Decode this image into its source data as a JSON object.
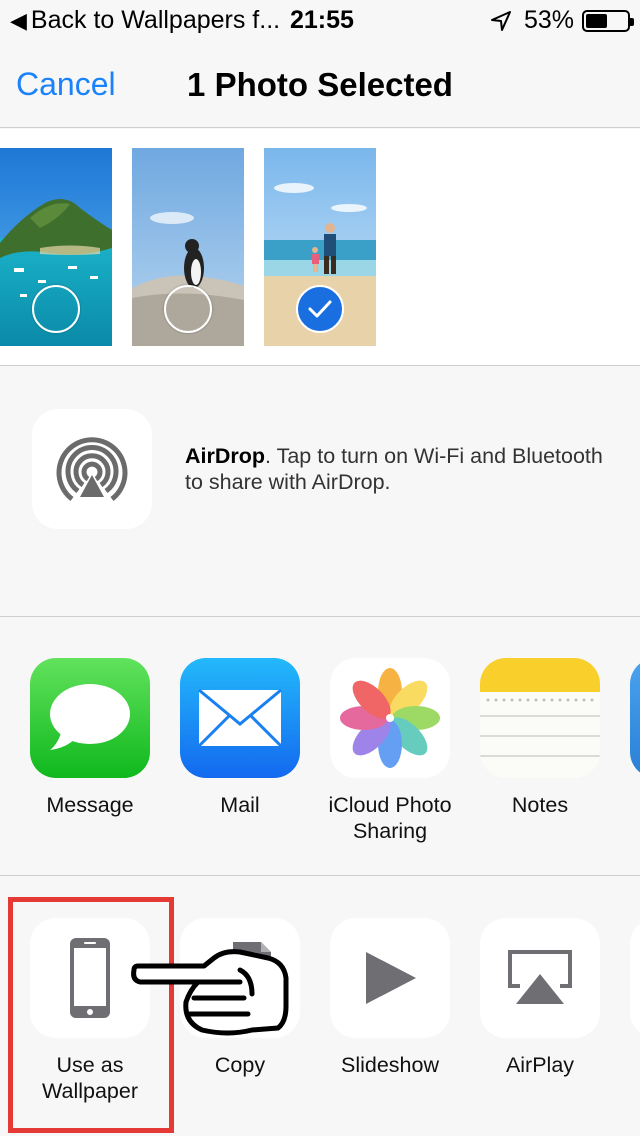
{
  "status_bar": {
    "back_label": "Back to Wallpapers f...",
    "time": "21:55",
    "battery": "53%",
    "battery_level": 0.53
  },
  "nav": {
    "cancel": "Cancel",
    "title": "1 Photo Selected"
  },
  "photos": [
    {
      "name": "Island bay with boats",
      "selected": false
    },
    {
      "name": "Penguin on rock",
      "selected": false
    },
    {
      "name": "Beach walk",
      "selected": true
    }
  ],
  "airdrop": {
    "title": "AirDrop",
    "message": ". Tap to turn on Wi-Fi and Bluetooth to share with AirDrop."
  },
  "share_apps": [
    {
      "label": "Message",
      "icon": "messages-icon"
    },
    {
      "label": "Mail",
      "icon": "mail-icon"
    },
    {
      "label": "iCloud Photo Sharing",
      "icon": "photos-icon"
    },
    {
      "label": "Notes",
      "icon": "notes-icon"
    }
  ],
  "actions": [
    {
      "label": "Use as Wallpaper",
      "icon": "iphone-icon"
    },
    {
      "label": "Copy",
      "icon": "copy-icon"
    },
    {
      "label": "Slideshow",
      "icon": "play-icon"
    },
    {
      "label": "AirPlay",
      "icon": "airplay-icon"
    }
  ],
  "colors": {
    "accent": "#1a82fb",
    "highlight": "#e53935"
  }
}
